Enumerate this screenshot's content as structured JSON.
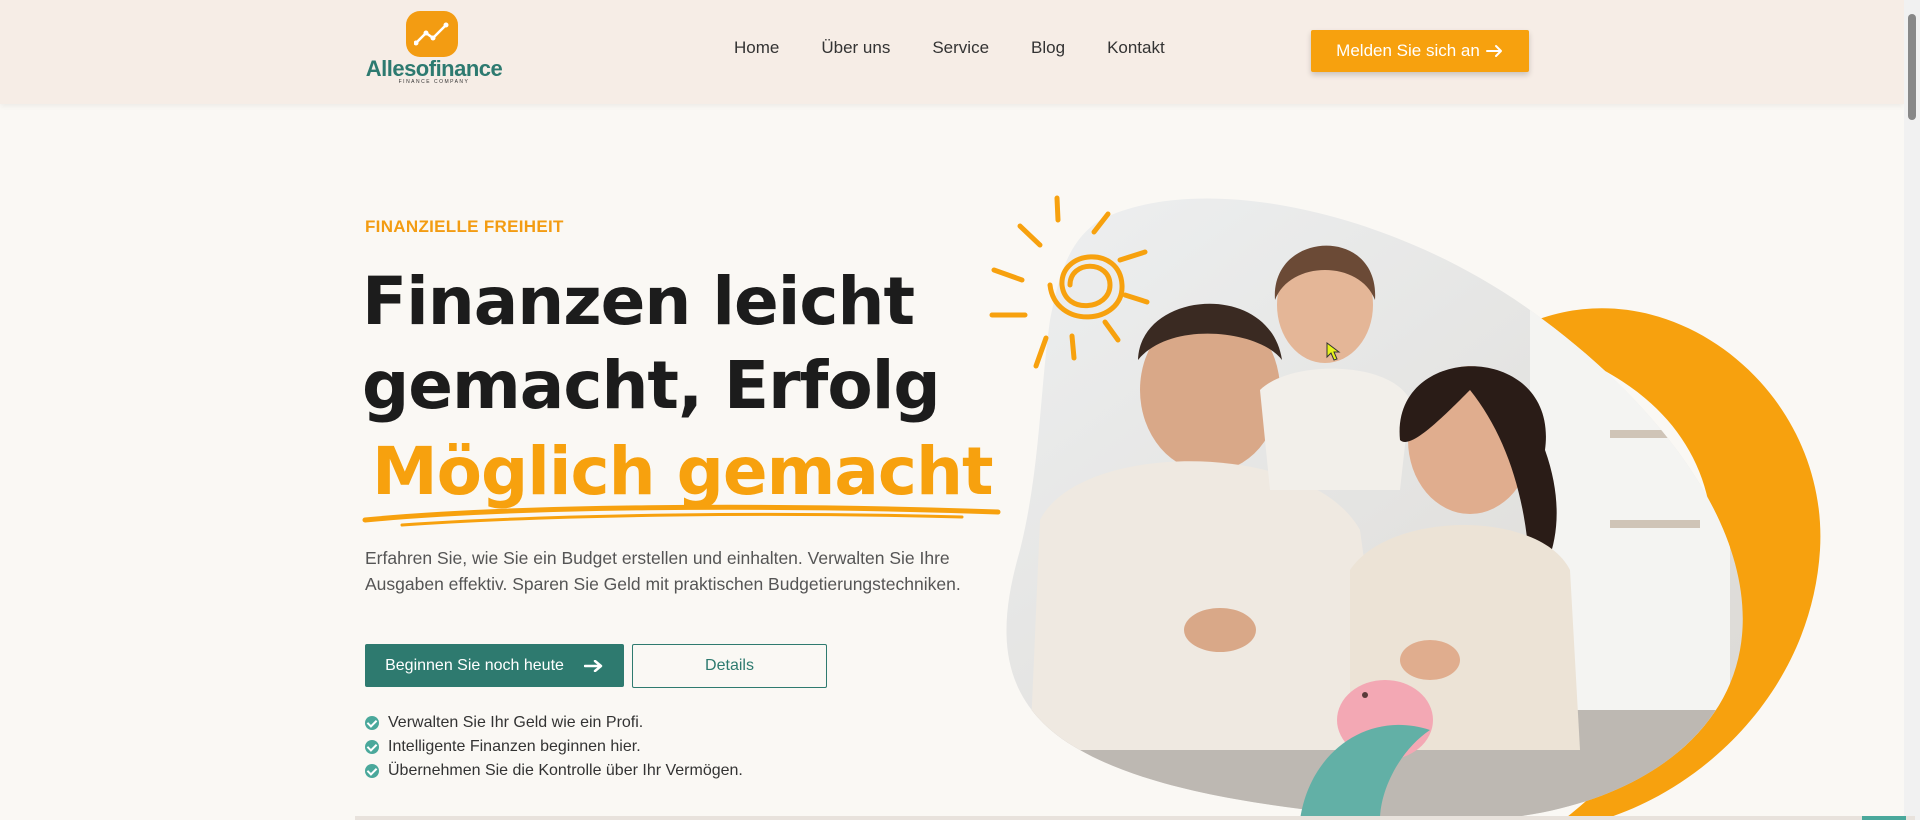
{
  "brand": {
    "name": "Allesofinance",
    "tagline": "FINANCE COMPANY",
    "accent": "#f7a10e",
    "primary": "#2e7a6f"
  },
  "nav": {
    "items": [
      {
        "label": "Home"
      },
      {
        "label": "Über uns"
      },
      {
        "label": "Service"
      },
      {
        "label": "Blog"
      },
      {
        "label": "Kontakt"
      }
    ]
  },
  "header": {
    "signup_label": "Melden Sie sich an",
    "signup_icon": "arrow-right-icon"
  },
  "hero": {
    "eyebrow": "FINANZIELLE FREIHEIT",
    "headline_line1": "Finanzen leicht",
    "headline_line2": "gemacht, Erfolg",
    "highlight": "Möglich gemacht",
    "lead": "Erfahren Sie, wie Sie ein Budget erstellen und einhalten. Verwalten Sie Ihre Ausgaben effektiv. Sparen Sie Geld mit praktischen Budgetierungstechniken.",
    "cta_primary": "Beginnen Sie noch heute",
    "cta_secondary": "Details",
    "checks": [
      "Verwalten Sie Ihr Geld wie ein Profi.",
      "Intelligente Finanzen beginnen hier.",
      "Übernehmen Sie die Kontrolle über Ihr Vermögen."
    ],
    "image": "family-piggy-bank-photo"
  }
}
